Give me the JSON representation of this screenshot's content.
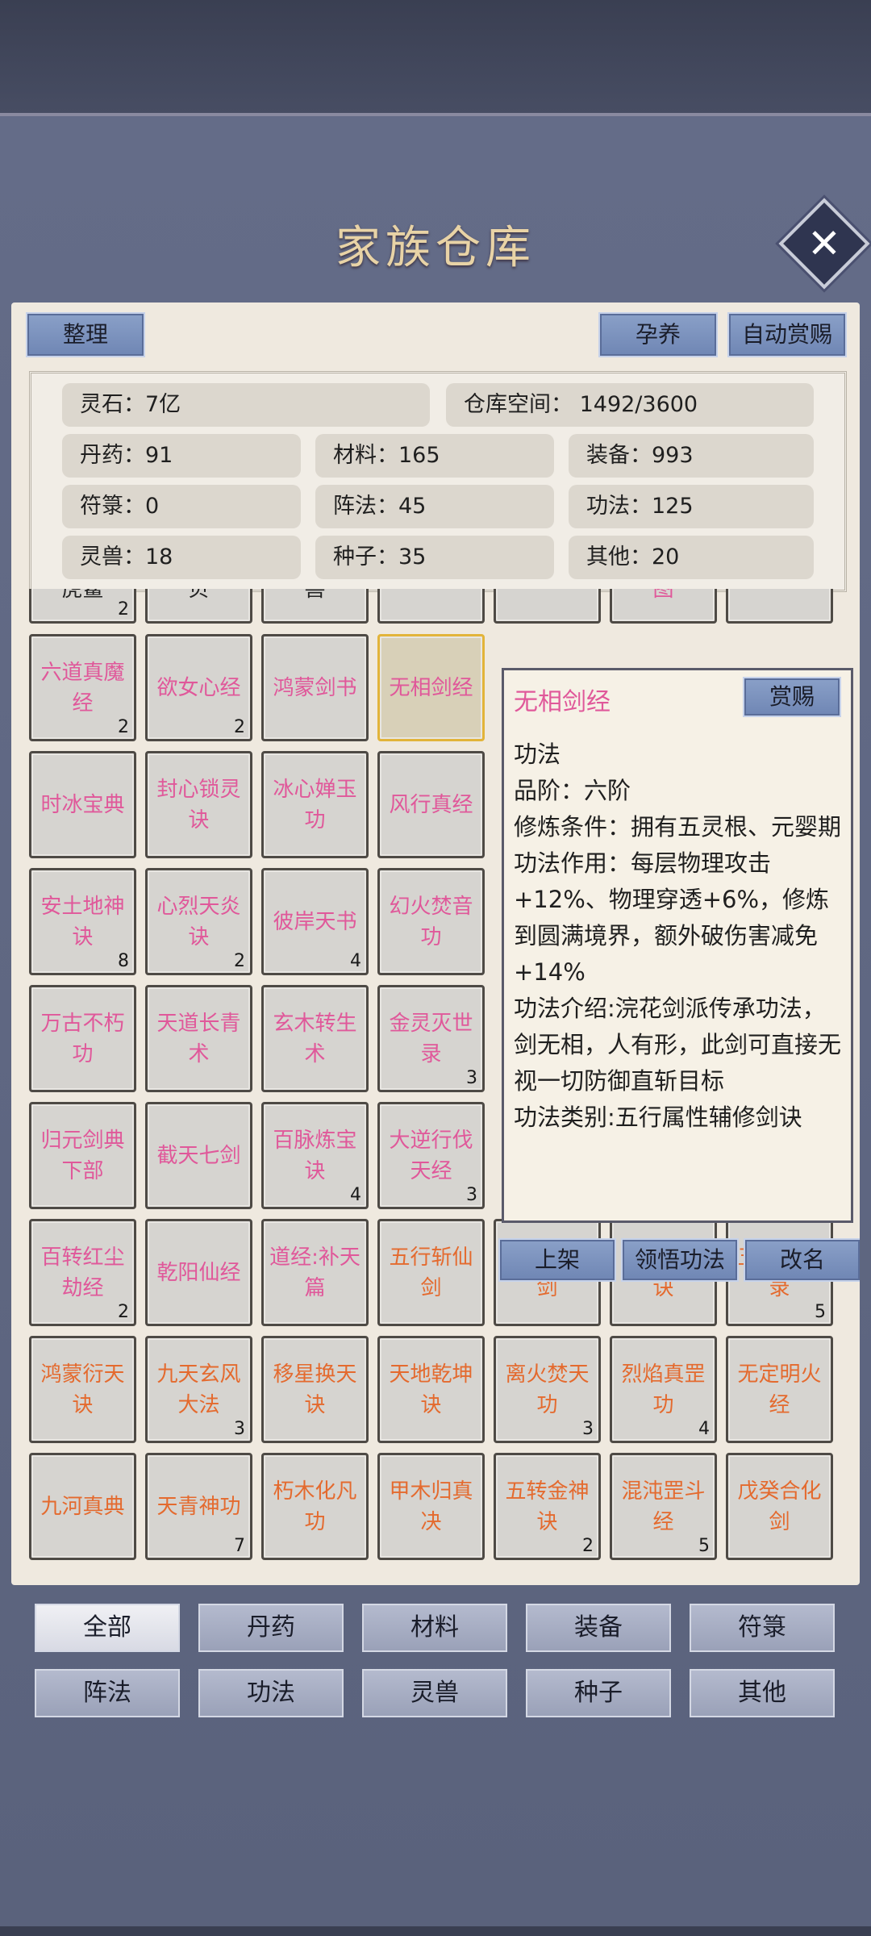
{
  "title": "家族仓库",
  "close_symbol": "✕",
  "toolbar": {
    "sort": "整理",
    "breed": "孕养",
    "auto_reward": "自动赏赐"
  },
  "stats": {
    "spirit_stone": "灵石：7亿",
    "storage": "仓库空间：    1492/3600",
    "pills": "丹药：91",
    "materials": "材料：165",
    "equipment": "装备：993",
    "talismans": "符箓：0",
    "formations": "阵法：45",
    "techniques": "功法：125",
    "beasts": "灵兽：18",
    "seeds": "种子：35",
    "other": "其他：20"
  },
  "grid": {
    "partial_row": [
      {
        "name": "虎鲨",
        "count": "2",
        "color": "dark"
      },
      {
        "name": "贝",
        "count": "",
        "color": "dark"
      },
      {
        "name": "兽",
        "count": "",
        "color": "dark"
      },
      {
        "name": "",
        "count": "",
        "color": "pink"
      },
      {
        "name": "",
        "count": "",
        "color": "pink"
      },
      {
        "name": "图",
        "count": "",
        "color": "pink"
      },
      {
        "name": "",
        "count": "",
        "color": "pink"
      }
    ],
    "rows": [
      [
        {
          "name": "六道真魔经",
          "count": "2",
          "color": "pink"
        },
        {
          "name": "欲女心经",
          "count": "2",
          "color": "pink"
        },
        {
          "name": "鸿蒙剑书",
          "count": "",
          "color": "pink"
        },
        {
          "name": "无相剑经",
          "count": "",
          "color": "pink"
        }
      ],
      [
        {
          "name": "时冰宝典",
          "count": "",
          "color": "pink"
        },
        {
          "name": "封心锁灵诀",
          "count": "",
          "color": "pink"
        },
        {
          "name": "冰心婵玉功",
          "count": "",
          "color": "pink"
        },
        {
          "name": "风行真经",
          "count": "",
          "color": "pink"
        }
      ],
      [
        {
          "name": "安土地神诀",
          "count": "8",
          "color": "pink"
        },
        {
          "name": "心烈天炎诀",
          "count": "2",
          "color": "pink"
        },
        {
          "name": "彼岸天书",
          "count": "4",
          "color": "pink"
        },
        {
          "name": "幻火焚音功",
          "count": "",
          "color": "pink"
        }
      ],
      [
        {
          "name": "万古不朽功",
          "count": "",
          "color": "pink"
        },
        {
          "name": "天道长青术",
          "count": "",
          "color": "pink"
        },
        {
          "name": "玄木转生术",
          "count": "",
          "color": "pink"
        },
        {
          "name": "金灵灭世录",
          "count": "3",
          "color": "pink"
        }
      ],
      [
        {
          "name": "归元剑典下部",
          "count": "",
          "color": "pink"
        },
        {
          "name": "截天七剑",
          "count": "",
          "color": "pink"
        },
        {
          "name": "百脉炼宝诀",
          "count": "4",
          "color": "pink"
        },
        {
          "name": "大逆行伐天经",
          "count": "3",
          "color": "pink"
        }
      ],
      [
        {
          "name": "百转红尘劫经",
          "count": "2",
          "color": "pink"
        },
        {
          "name": "乾阳仙经",
          "count": "",
          "color": "pink"
        },
        {
          "name": "道经:补天篇",
          "count": "",
          "color": "pink"
        },
        {
          "name": "五行斩仙剑",
          "count": "",
          "color": "orange"
        },
        {
          "name": "通天斩魔剑",
          "count": "",
          "color": "orange"
        },
        {
          "name": "阴阳化极诀",
          "count": "",
          "color": "orange"
        },
        {
          "name": "五行禁神录",
          "count": "5",
          "color": "orange"
        }
      ],
      [
        {
          "name": "鸿蒙衍天诀",
          "count": "",
          "color": "orange"
        },
        {
          "name": "九天玄风大法",
          "count": "3",
          "color": "orange"
        },
        {
          "name": "移星换天诀",
          "count": "",
          "color": "orange"
        },
        {
          "name": "天地乾坤诀",
          "count": "",
          "color": "orange"
        },
        {
          "name": "离火焚天功",
          "count": "3",
          "color": "orange"
        },
        {
          "name": "烈焰真罡功",
          "count": "4",
          "color": "orange"
        },
        {
          "name": "无定明火经",
          "count": "",
          "color": "orange"
        }
      ],
      [
        {
          "name": "九河真典",
          "count": "",
          "color": "orange"
        },
        {
          "name": "天青神功",
          "count": "7",
          "color": "orange"
        },
        {
          "name": "朽木化凡功",
          "count": "",
          "color": "orange"
        },
        {
          "name": "甲木归真决",
          "count": "",
          "color": "orange"
        },
        {
          "name": "五转金神诀",
          "count": "2",
          "color": "orange"
        },
        {
          "name": "混沌罡斗经",
          "count": "5",
          "color": "orange"
        },
        {
          "name": "戊癸合化剑",
          "count": "",
          "color": "orange"
        }
      ]
    ]
  },
  "tooltip": {
    "title": "无相剑经",
    "reward": "赏赐",
    "text": "功法\n品阶：六阶\n修炼条件：拥有五灵根、元婴期\n功法作用：每层物理攻击+12%、物理穿透+6%，修炼到圆满境界，额外破伤害减免+14%\n功法介绍:浣花剑派传承功法，剑无相，人有形，此剑可直接无视一切防御直斩目标\n功法类别:五行属性辅修剑诀"
  },
  "actions": {
    "shelve": "上架",
    "comprehend": "领悟功法",
    "rename": "改名"
  },
  "tabs": [
    "全部",
    "丹药",
    "材料",
    "装备",
    "符箓",
    "阵法",
    "功法",
    "灵兽",
    "种子",
    "其他"
  ],
  "active_tab": "全部"
}
